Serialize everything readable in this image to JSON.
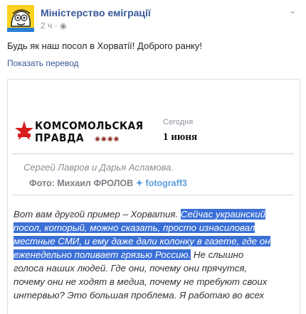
{
  "post": {
    "page_name": "Міністерство еміграції",
    "time": "2 ч",
    "text": "Будь як наш посол в Хорватії! Доброго ранку!",
    "translate_link": "Показать перевод"
  },
  "news": {
    "logo_line1": "КОМСОМОЛЬСКАЯ",
    "logo_line2": "ПРАВДА",
    "date_label": "Сегодня",
    "date_value": "1 июня",
    "caption": "Сергей Лавров и Дарья Асламова.",
    "photo_label": "Фото: Михаил ФРОЛОВ",
    "twitter_handle": "fotograff3",
    "lines": [
      [
        {
          "t": "Вот вам другой пример – Хорватия. ",
          "hl": false
        },
        {
          "t": "Сейчас украинский",
          "hl": true
        }
      ],
      [
        {
          "t": "посол, который, можно сказать, просто изнасиловал",
          "hl": true
        }
      ],
      [
        {
          "t": "местные СМИ, и ему даже дали колонку в газете, где он",
          "hl": true
        }
      ],
      [
        {
          "t": "еженедельно поливает грязью Россию.",
          "hl": true
        },
        {
          "t": " Не слышно",
          "hl": false
        }
      ],
      [
        {
          "t": "голоса наших людей. Где они, почему они прячутся,",
          "hl": false
        }
      ],
      [
        {
          "t": "почему они не ходят в медиа, почему не требуют своих",
          "hl": false
        }
      ],
      [
        {
          "t": "интервью? Это большая проблема. Я работаю во всех",
          "hl": false
        }
      ]
    ]
  },
  "colors": {
    "link": "#365899",
    "highlight": "#3b70d6",
    "avatar_bg": "#ffd21f"
  },
  "icons": {
    "avatar": "cartoon-face-icon",
    "privacy": "globe-icon",
    "menu": "chevron-down-icon",
    "twitter": "twitter-bird-icon",
    "kp_star": "kp-star-icon"
  }
}
